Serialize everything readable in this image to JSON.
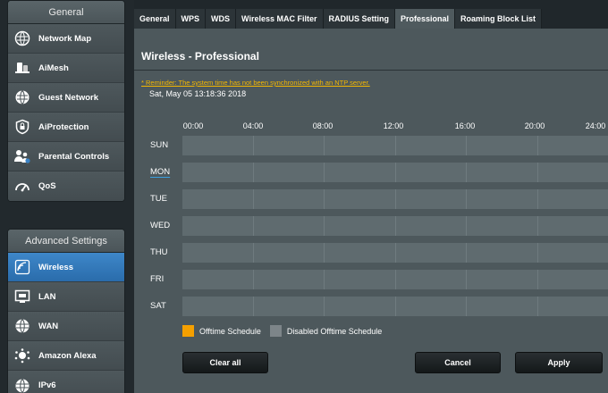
{
  "sidebar": {
    "general_header": "General",
    "general_items": [
      {
        "label": "Network Map",
        "icon": "network-map-icon"
      },
      {
        "label": "AiMesh",
        "icon": "aimesh-icon"
      },
      {
        "label": "Guest Network",
        "icon": "guest-network-icon"
      },
      {
        "label": "AiProtection",
        "icon": "aiprotection-icon"
      },
      {
        "label": "Parental Controls",
        "icon": "parental-controls-icon"
      },
      {
        "label": "QoS",
        "icon": "qos-icon"
      }
    ],
    "advanced_header": "Advanced Settings",
    "advanced_items": [
      {
        "label": "Wireless",
        "icon": "wireless-icon",
        "active": true
      },
      {
        "label": "LAN",
        "icon": "lan-icon"
      },
      {
        "label": "WAN",
        "icon": "wan-icon"
      },
      {
        "label": "Amazon Alexa",
        "icon": "alexa-icon"
      },
      {
        "label": "IPv6",
        "icon": "ipv6-icon"
      }
    ]
  },
  "tabs": [
    {
      "label": "General"
    },
    {
      "label": "WPS"
    },
    {
      "label": "WDS"
    },
    {
      "label": "Wireless MAC Filter"
    },
    {
      "label": "RADIUS Setting"
    },
    {
      "label": "Professional",
      "active": true
    },
    {
      "label": "Roaming Block List"
    }
  ],
  "panel": {
    "title": "Wireless - Professional",
    "reminder": "* Reminder: The system time has not been synchronized with an NTP server.",
    "system_time": "Sat, May 05 13:18:36 2018"
  },
  "schedule": {
    "time_labels": [
      "00:00",
      "04:00",
      "08:00",
      "12:00",
      "16:00",
      "20:00",
      "24:00"
    ],
    "days": [
      "SUN",
      "MON",
      "TUE",
      "WED",
      "THU",
      "FRI",
      "SAT"
    ],
    "legend": {
      "offtime": "Offtime Schedule",
      "disabled": "Disabled Offtime Schedule"
    }
  },
  "colors": {
    "offtime": "#f5a000",
    "disabled": "#7d8589",
    "active_menu": "#3a82c4",
    "reminder": "#f5b800"
  },
  "buttons": {
    "clear_all": "Clear all",
    "cancel": "Cancel",
    "apply": "Apply"
  }
}
